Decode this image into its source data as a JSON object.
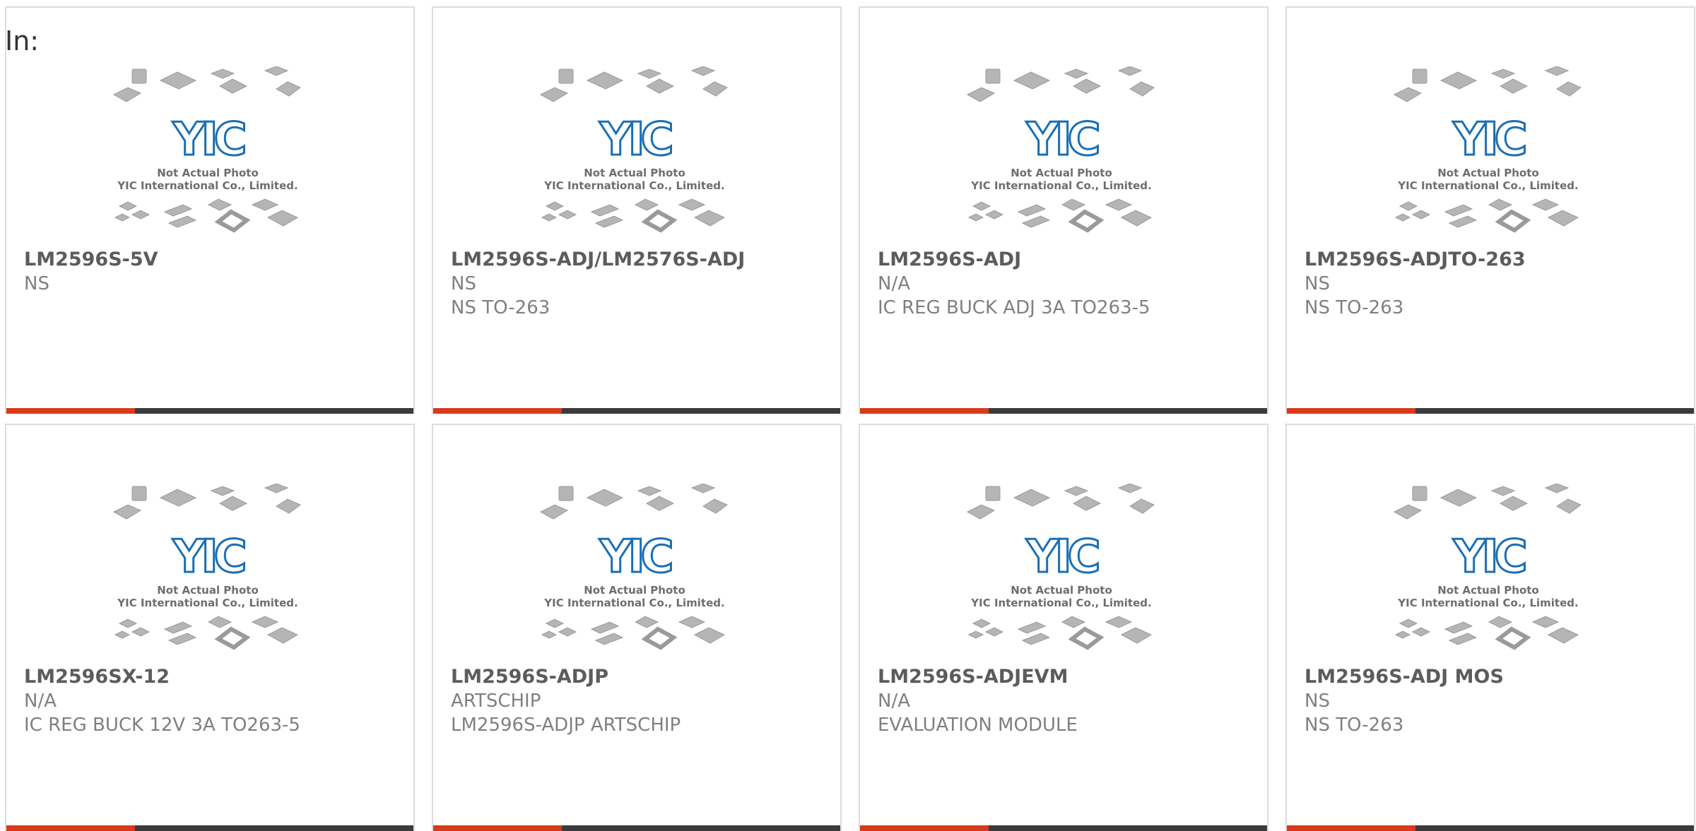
{
  "page": {
    "label": "In:"
  },
  "placeholder": {
    "caption_line1": "Not Actual Photo",
    "caption_line2": "YIC International Co., Limited.",
    "logo_text": "YIC",
    "icon": "chip-packages-placeholder-icon"
  },
  "colors": {
    "accent": "#d93a1b",
    "bar": "#3b3b3b",
    "logo": "#1a6fb5"
  },
  "products": [
    {
      "part": "LM2596S-5V",
      "manufacturer": "NS",
      "description": ""
    },
    {
      "part": "LM2596S-ADJ/LM2576S-ADJ",
      "manufacturer": "NS",
      "description": "NS TO-263"
    },
    {
      "part": "LM2596S-ADJ",
      "manufacturer": "N/A",
      "description": "IC REG BUCK ADJ 3A TO263-5"
    },
    {
      "part": "LM2596S-ADJTO-263",
      "manufacturer": "NS",
      "description": "NS TO-263"
    },
    {
      "part": "LM2596SX-12",
      "manufacturer": "N/A",
      "description": "IC REG BUCK 12V 3A TO263-5"
    },
    {
      "part": "LM2596S-ADJP",
      "manufacturer": "ARTSCHIP",
      "description": "LM2596S-ADJP ARTSCHIP"
    },
    {
      "part": "LM2596S-ADJEVM",
      "manufacturer": "N/A",
      "description": "EVALUATION MODULE"
    },
    {
      "part": "LM2596S-ADJ MOS",
      "manufacturer": "NS",
      "description": "NS TO-263"
    }
  ]
}
